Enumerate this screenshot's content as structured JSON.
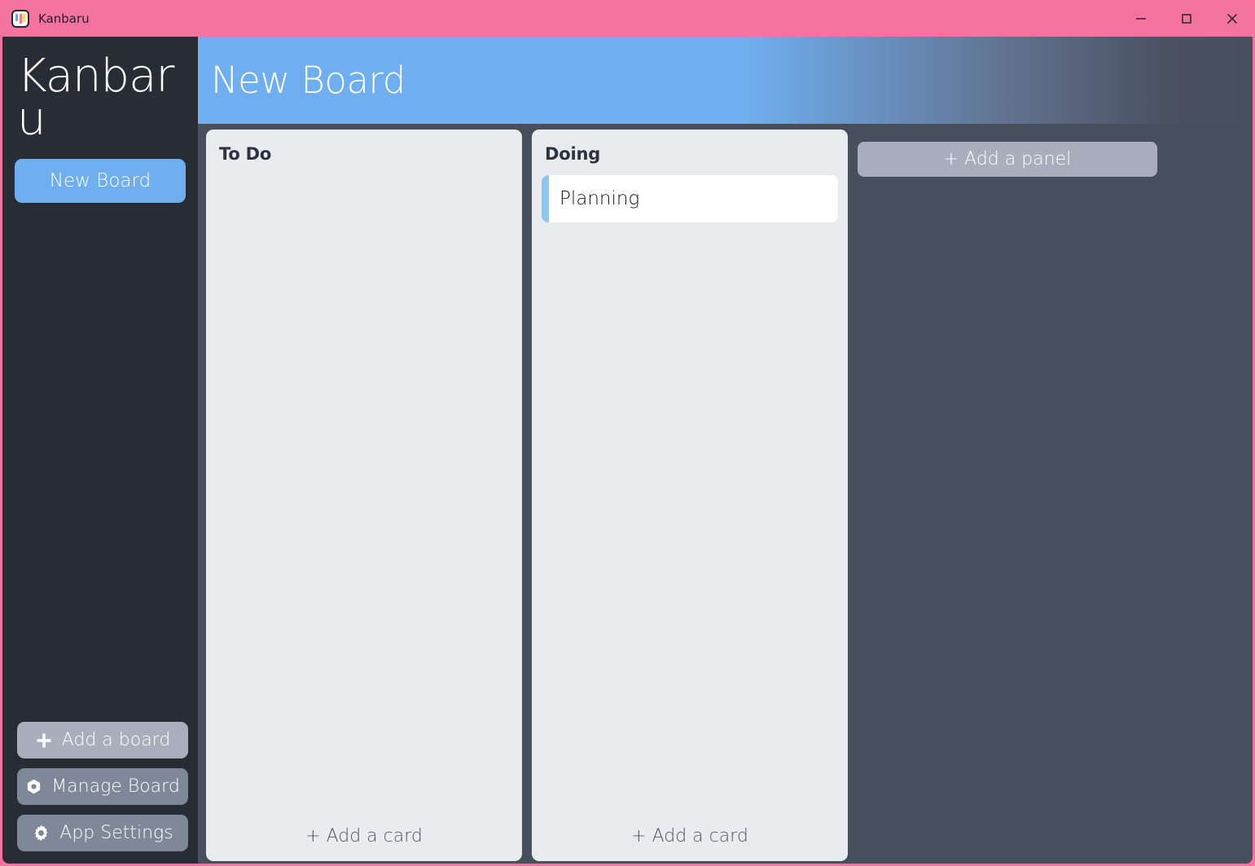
{
  "window": {
    "app_title": "Kanbaru",
    "app_icon": "kanban-board-icon",
    "controls": {
      "minimize": "minimize-icon",
      "maximize": "maximize-icon",
      "close": "close-icon"
    }
  },
  "sidebar": {
    "logo": "Kanbaru",
    "boards": [
      {
        "label": "New Board",
        "selected": true
      }
    ],
    "actions": [
      {
        "label": "Add a board",
        "icon": "plus-icon",
        "style": "light"
      },
      {
        "label": "Manage Board",
        "icon": "hexagon-nut-icon",
        "style": "mid"
      },
      {
        "label": "App Settings",
        "icon": "gear-icon",
        "style": "mid"
      }
    ]
  },
  "header": {
    "title": "New Board"
  },
  "board": {
    "add_panel_label": "+ Add a panel",
    "add_card_label": "+ Add a card",
    "panels": [
      {
        "title": "To Do",
        "cards": []
      },
      {
        "title": "Doing",
        "cards": [
          {
            "label": "Planning",
            "accent": "#8ec5f8"
          }
        ]
      }
    ]
  },
  "colors": {
    "titlebar": "#f5749f",
    "sidebar": "#272c35",
    "board_background": "#474e5c",
    "panel": "#e9ebef",
    "accent_blue": "#6fafef",
    "card_accent": "#8ec5f8",
    "button_light": "#a8aebc",
    "button_mid": "#7f8899"
  }
}
